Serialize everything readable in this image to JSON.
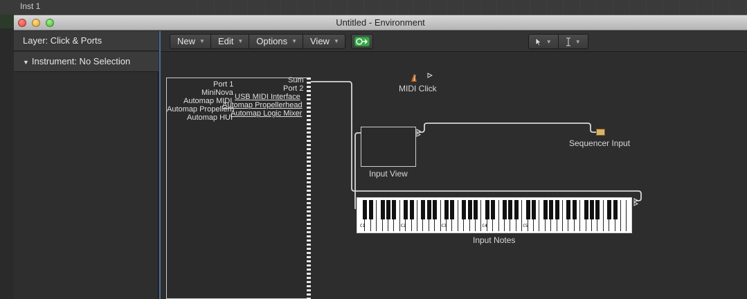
{
  "background": {
    "track_title": "Inst 1"
  },
  "window": {
    "title": "Untitled - Environment"
  },
  "inspector": {
    "layer_label": "Layer: Click & Ports",
    "instrument_label": "Instrument:  No Selection"
  },
  "toolbar": {
    "menus": [
      "New",
      "Edit",
      "Options",
      "View"
    ]
  },
  "canvas": {
    "ports_left": [
      "Port 1",
      "MiniNova",
      "Automap MIDI",
      "Automap Propellerh",
      "Automap HUI"
    ],
    "ports_right": [
      "Sum",
      "Port 2",
      "USB MIDI Interface",
      "Automap Propellerhead",
      "Automap Logic Mixer"
    ],
    "midi_click_label": "MIDI Click",
    "sequencer_input_label": "Sequencer Input",
    "input_view_label": "Input View",
    "input_notes_label": "Input Notes",
    "octave_labels": [
      "C1",
      "C2",
      "C3",
      "C4",
      "C5"
    ]
  },
  "colors": {
    "accent_border": "#4a6fa0",
    "midi_button": "#3aa54a",
    "wire": "#d8d8d8"
  },
  "icons": {
    "midi_thru": "midi-thru-icon",
    "pointer_tool": "pointer-icon",
    "text_tool": "text-cursor-icon"
  }
}
